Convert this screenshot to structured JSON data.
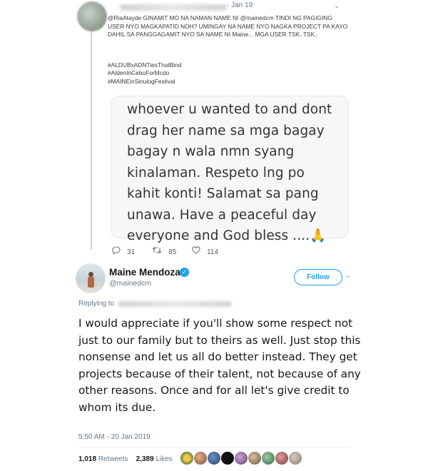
{
  "top_tweet": {
    "date": "· Jan 19",
    "text": "@RiaAtayde GINAMIT MO NA NAMAN NAME NI @mainedcm TINDI NG PAGIGING USER NYO MAGKAPATID NOH? UMINGAY NA NAME NYO NAGKA PROJECT PA KAYO DAHIL SA PANGGAGAMIT NYO SA NAME NI Maine... MGA USER TSK..TSK..",
    "hashtags": [
      "#ALDUBxADNTiesThatBind",
      "#AldenInCebuForMcdo",
      "#MAINEinSinulogFestival"
    ],
    "media_lines": [
      "whoever u wanted to and dont",
      "drag her name sa mga bagay",
      "bagay n wala nmn syang",
      "kinalaman.  Respeto lng po",
      "kahit konti! Salamat sa pang",
      "unawa. Have a peaceful day",
      "everyone and God bless ....🙏"
    ],
    "replies": "31",
    "retweets": "85",
    "likes": "114"
  },
  "main_tweet": {
    "display_name": "Maine Mendoza",
    "handle": "@mainedcm",
    "follow_label": "Follow",
    "replying_label": "Replying to",
    "body": "I would appreciate if you'll show some respect not just to our family but to theirs as well. Just stop this nonsense and let us all do better instead. They get projects because of their talent, not because of any other reasons. Once and for all let's give credit to whom its due.",
    "timestamp": "5:50 AM - 20 Jan 2019",
    "retweet_count": "1,018",
    "retweet_label": "Retweets",
    "like_count": "2,389",
    "like_label": "Likes"
  },
  "icons": {
    "reply": "reply-icon",
    "retweet": "retweet-icon",
    "like": "heart-icon",
    "verified": "verified-badge-icon",
    "more": "chevron-down-icon"
  },
  "colors": {
    "accent": "#1da1f2",
    "muted": "#657786",
    "text": "#14171a"
  }
}
